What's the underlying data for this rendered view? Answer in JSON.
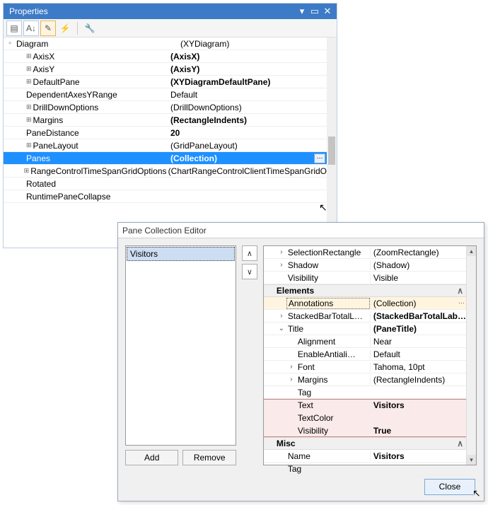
{
  "properties": {
    "title": "Properties",
    "rows": [
      {
        "name": "Diagram",
        "value": "(XYDiagram)",
        "indent": 0,
        "expander": "-",
        "plus": false
      },
      {
        "name": "AxisX",
        "value": "(AxisX)",
        "indent": 1,
        "expander": "",
        "plus": true,
        "bold": true
      },
      {
        "name": "AxisY",
        "value": "(AxisY)",
        "indent": 1,
        "expander": "",
        "plus": true,
        "bold": true
      },
      {
        "name": "DefaultPane",
        "value": "(XYDiagramDefaultPane)",
        "indent": 1,
        "expander": "",
        "plus": true,
        "bold": true
      },
      {
        "name": "DependentAxesYRange",
        "value": "Default",
        "indent": 1,
        "expander": "",
        "plus": false
      },
      {
        "name": "DrillDownOptions",
        "value": "(DrillDownOptions)",
        "indent": 1,
        "expander": "",
        "plus": true
      },
      {
        "name": "Margins",
        "value": "(RectangleIndents)",
        "indent": 1,
        "expander": "",
        "plus": true,
        "bold": true
      },
      {
        "name": "PaneDistance",
        "value": "20",
        "indent": 1,
        "expander": "",
        "plus": false,
        "bold": true
      },
      {
        "name": "PaneLayout",
        "value": "(GridPaneLayout)",
        "indent": 1,
        "expander": "",
        "plus": true
      },
      {
        "name": "Panes",
        "value": "(Collection)",
        "indent": 1,
        "expander": "",
        "plus": false,
        "bold": true,
        "selected": true,
        "ellipsis": true
      },
      {
        "name": "RangeControlTimeSpanGridOptions",
        "value": "(ChartRangeControlClientTimeSpanGridO",
        "indent": 1,
        "expander": "",
        "plus": true
      },
      {
        "name": "Rotated",
        "value": "",
        "indent": 1,
        "expander": "",
        "plus": false
      },
      {
        "name": "RuntimePaneCollapse",
        "value": "",
        "indent": 1,
        "expander": "",
        "plus": false
      }
    ]
  },
  "editor": {
    "title": "Pane Collection Editor",
    "list_item": "Visitors",
    "add_label": "Add",
    "remove_label": "Remove",
    "close_label": "Close",
    "cat_elements": "Elements",
    "cat_misc": "Misc",
    "rows": {
      "selRect": {
        "n": "SelectionRectangle",
        "v": "(ZoomRectangle)"
      },
      "shadow": {
        "n": "Shadow",
        "v": "(Shadow)"
      },
      "visibility": {
        "n": "Visibility",
        "v": "Visible"
      },
      "annotations": {
        "n": "Annotations",
        "v": "(Collection)"
      },
      "stacked": {
        "n": "StackedBarTotalL…",
        "v": "(StackedBarTotalLab…"
      },
      "title": {
        "n": "Title",
        "v": "(PaneTitle)"
      },
      "alignment": {
        "n": "Alignment",
        "v": "Near"
      },
      "antialias": {
        "n": "EnableAntiali…",
        "v": "Default"
      },
      "font": {
        "n": "Font",
        "v": "Tahoma, 10pt"
      },
      "margins": {
        "n": "Margins",
        "v": "(RectangleIndents)"
      },
      "tag": {
        "n": "Tag",
        "v": ""
      },
      "text": {
        "n": "Text",
        "v": "Visitors"
      },
      "textcolor": {
        "n": "TextColor",
        "v": ""
      },
      "vis2": {
        "n": "Visibility",
        "v": "True"
      },
      "miscname": {
        "n": "Name",
        "v": "Visitors"
      },
      "misctag": {
        "n": "Tag",
        "v": ""
      }
    }
  }
}
